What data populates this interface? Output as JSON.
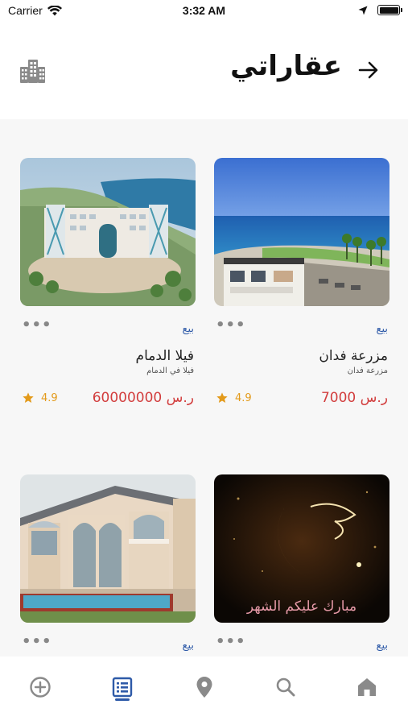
{
  "status_bar": {
    "carrier": "Carrier",
    "time": "3:32 AM"
  },
  "header": {
    "title": "عقاراتي"
  },
  "listings": [
    {
      "type": "بيع",
      "title": "مزرعة فدان",
      "subtitle": "مزرعة فدان",
      "price": "7000 ر.س",
      "rating": "4.9"
    },
    {
      "type": "بيع",
      "title": "فيلا الدمام",
      "subtitle": "فيلا في الدمام",
      "price": "60000000 ر.س",
      "rating": "4.9"
    },
    {
      "type": "بيع",
      "image_text": "مبارك عليكم الشهر"
    },
    {
      "type": "بيع"
    }
  ],
  "tabs": [
    {
      "name": "home",
      "icon": "home-icon"
    },
    {
      "name": "search",
      "icon": "search-icon"
    },
    {
      "name": "location",
      "icon": "location-pin-icon"
    },
    {
      "name": "my-properties",
      "icon": "list-icon",
      "active": true
    },
    {
      "name": "add",
      "icon": "add-circle-icon"
    }
  ],
  "colors": {
    "accent": "#2e5aa8",
    "price": "#d23d3d",
    "rating": "#e39a1a",
    "icon_gray": "#8a8a8a"
  }
}
